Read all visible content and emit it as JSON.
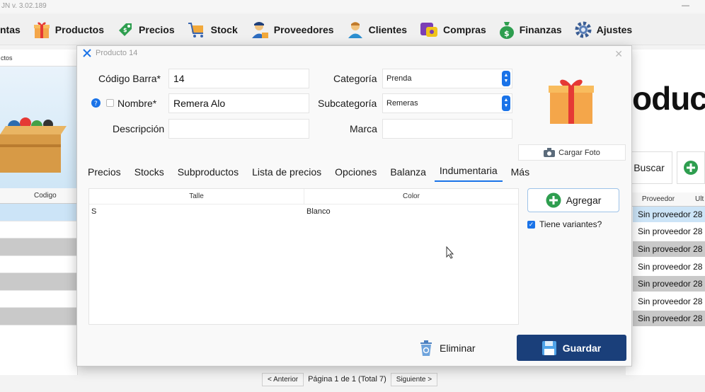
{
  "app": {
    "title_fragment": "JN v. 3.02.189"
  },
  "toolbar": {
    "items": [
      {
        "label": "ntas"
      },
      {
        "label": "Productos"
      },
      {
        "label": "Precios"
      },
      {
        "label": "Stock"
      },
      {
        "label": "Proveedores"
      },
      {
        "label": "Clientes"
      },
      {
        "label": "Compras"
      },
      {
        "label": "Finanzas"
      },
      {
        "label": "Ajustes"
      }
    ]
  },
  "background": {
    "left_tab": "ctos",
    "left_header": "Codigo",
    "big_title": "oduct",
    "search_label": "Buscar",
    "right_header_proveedor": "Proveedor",
    "right_header_ult": "Ult",
    "rows": [
      {
        "proveedor": "Sin proveedor",
        "ult": "28"
      },
      {
        "proveedor": "Sin proveedor",
        "ult": "28"
      },
      {
        "proveedor": "Sin proveedor",
        "ult": "28"
      },
      {
        "proveedor": "Sin proveedor",
        "ult": "28"
      },
      {
        "proveedor": "Sin proveedor",
        "ult": "28"
      },
      {
        "proveedor": "Sin proveedor",
        "ult": "28"
      },
      {
        "proveedor": "Sin proveedor",
        "ult": "28"
      }
    ],
    "pager": {
      "prev": "< Anterior",
      "info": "Página 1 de 1 (Total 7)",
      "next": "Siguiente >"
    }
  },
  "dialog": {
    "title": "Producto 14",
    "fields": {
      "codigo_label": "Código Barra*",
      "codigo_value": "14",
      "nombre_label": "Nombre*",
      "nombre_value": "Remera Alo",
      "descripcion_label": "Descripción",
      "descripcion_value": "",
      "categoria_label": "Categoría",
      "categoria_value": "Prenda",
      "subcategoria_label": "Subcategoría",
      "subcategoria_value": "Remeras",
      "marca_label": "Marca",
      "marca_value": ""
    },
    "photo_button": "Cargar Foto",
    "tabs": [
      {
        "label": "Precios",
        "active": false
      },
      {
        "label": "Stocks",
        "active": false
      },
      {
        "label": "Subproductos",
        "active": false
      },
      {
        "label": "Lista de precios",
        "active": false
      },
      {
        "label": "Opciones",
        "active": false
      },
      {
        "label": "Balanza",
        "active": false
      },
      {
        "label": "Indumentaria",
        "active": true
      },
      {
        "label": "Más",
        "active": false
      }
    ],
    "grid": {
      "columns": [
        "Talle",
        "Color"
      ],
      "rows": [
        {
          "talle": "S",
          "color": "Blanco"
        }
      ]
    },
    "add_button": "Agregar",
    "variantes_label": "Tiene variantes?",
    "variantes_checked": true,
    "delete_button": "Eliminar",
    "save_button": "Guardar"
  },
  "colors": {
    "accent": "#1a73e8",
    "save_bg": "#1a3f7a",
    "selected_row": "#cce4f7",
    "gray_row": "#c9c9c9"
  }
}
